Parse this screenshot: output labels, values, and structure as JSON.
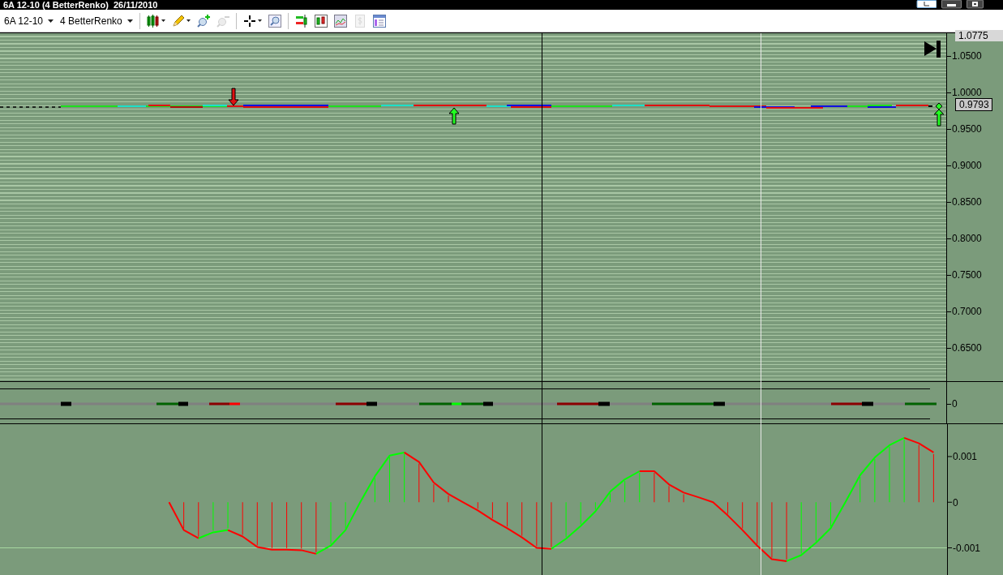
{
  "window": {
    "title": "6A 12-10 (4 BetterRenko)  26/11/2010",
    "buttons": [
      {
        "kind": "layout"
      },
      {
        "kind": "minimize"
      },
      {
        "kind": "restore"
      }
    ]
  },
  "toolbar": {
    "instrument": "6A 12-10",
    "bar_type": "4 BetterRenko",
    "tool_groups": [
      [
        {
          "kind": "candles",
          "dropdown": true,
          "disabled": false
        },
        {
          "kind": "pencil",
          "dropdown": true,
          "disabled": false
        },
        {
          "kind": "zoom-in",
          "dropdown": false,
          "disabled": false
        },
        {
          "kind": "zoom-out",
          "dropdown": false,
          "disabled": true
        }
      ],
      [
        {
          "kind": "crosshair",
          "dropdown": true,
          "disabled": false
        },
        {
          "kind": "zoom-box",
          "dropdown": false,
          "disabled": false
        }
      ],
      [
        {
          "kind": "strategy",
          "dropdown": false,
          "disabled": false
        },
        {
          "kind": "bars",
          "dropdown": false,
          "disabled": false
        },
        {
          "kind": "chart",
          "dropdown": false,
          "disabled": false
        },
        {
          "kind": "dollar",
          "dropdown": false,
          "disabled": true
        },
        {
          "kind": "properties",
          "dropdown": false,
          "disabled": false
        }
      ]
    ]
  },
  "price_panel": {
    "top_price": "1.0775",
    "current_price": "0.9793",
    "axis_labels": [
      "1.0500",
      "1.0000",
      "0.9500",
      "0.9000",
      "0.8500",
      "0.8000",
      "0.7500",
      "0.7000",
      "0.6500"
    ]
  },
  "signal_panel": {
    "axis_label": "0"
  },
  "oscillator_panel": {
    "chart_data": {
      "type": "line",
      "ylim": [
        -0.00163,
        0.00171
      ],
      "yticks": [
        {
          "value": 0.001,
          "label": "0.001"
        },
        {
          "value": 0,
          "label": "0"
        },
        {
          "value": -0.001,
          "label": "-0.001"
        }
      ],
      "series": [
        {
          "color": "#00ff00",
          "values": [
            null,
            null,
            null,
            null,
            null,
            null,
            null,
            null,
            null,
            null,
            null,
            null,
            null,
            -0.00079,
            -0.00066,
            -0.00061,
            null,
            null,
            null,
            null,
            null,
            -0.00113,
            -0.00095,
            -0.00061,
            0,
            0.00057,
            0.00102,
            0.00109,
            null,
            null,
            null,
            null,
            null,
            null,
            null,
            null,
            null,
            -0.00102,
            -0.0008,
            -0.00052,
            -0.0002,
            0.00023,
            0.0005,
            0.00068,
            null,
            null,
            null,
            null,
            null,
            null,
            null,
            null,
            null,
            -0.00129,
            -0.00116,
            -0.00089,
            -0.00057,
            0,
            0.00059,
            0.00098,
            0.00125,
            0.00141,
            null,
            null,
            null,
            null,
            null,
            null
          ]
        },
        {
          "color": "#ff0000",
          "values": [
            null,
            null,
            null,
            null,
            null,
            null,
            null,
            null,
            null,
            null,
            null,
            0,
            -0.00061,
            -0.00079,
            null,
            -0.00061,
            -0.00075,
            -0.00098,
            -0.00104,
            -0.00104,
            -0.00105,
            -0.00113,
            null,
            null,
            null,
            null,
            null,
            0.00109,
            0.00088,
            0.00043,
            0.00018,
            0,
            -0.00018,
            -0.00039,
            -0.00057,
            -0.00077,
            -0.001,
            -0.00102,
            null,
            null,
            null,
            null,
            null,
            0.00068,
            0.00068,
            0.00039,
            0.00021,
            0.00011,
            0,
            -0.00029,
            -0.00061,
            -0.00095,
            -0.00125,
            -0.00129,
            null,
            null,
            null,
            null,
            null,
            null,
            null,
            0.00141,
            0.00129,
            0.00109,
            null,
            null,
            null,
            null
          ]
        }
      ]
    }
  }
}
